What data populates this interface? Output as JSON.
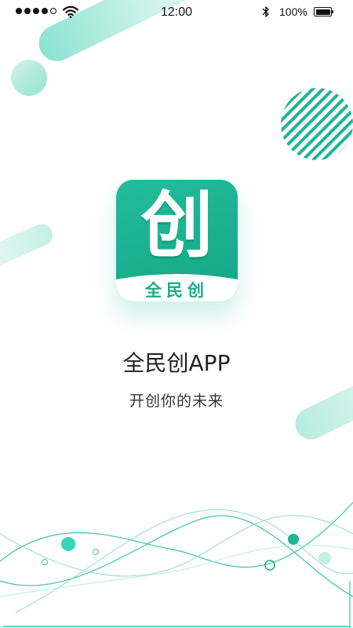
{
  "status_bar": {
    "time": "12:00",
    "battery_percent": "100%",
    "signal_bars_filled": 4,
    "signal_bars_total": 5,
    "icons": [
      "wifi-icon",
      "bluetooth-icon",
      "battery-icon"
    ]
  },
  "logo": {
    "main_char": "创",
    "band_text": "全民创"
  },
  "splash": {
    "title": "全民创APP",
    "subtitle": "开创你的未来"
  },
  "colors": {
    "brand": "#1aaa89",
    "brand_light": "#7ee0cd",
    "accent_pale": "#dff6f0",
    "text_dark": "#222222"
  }
}
